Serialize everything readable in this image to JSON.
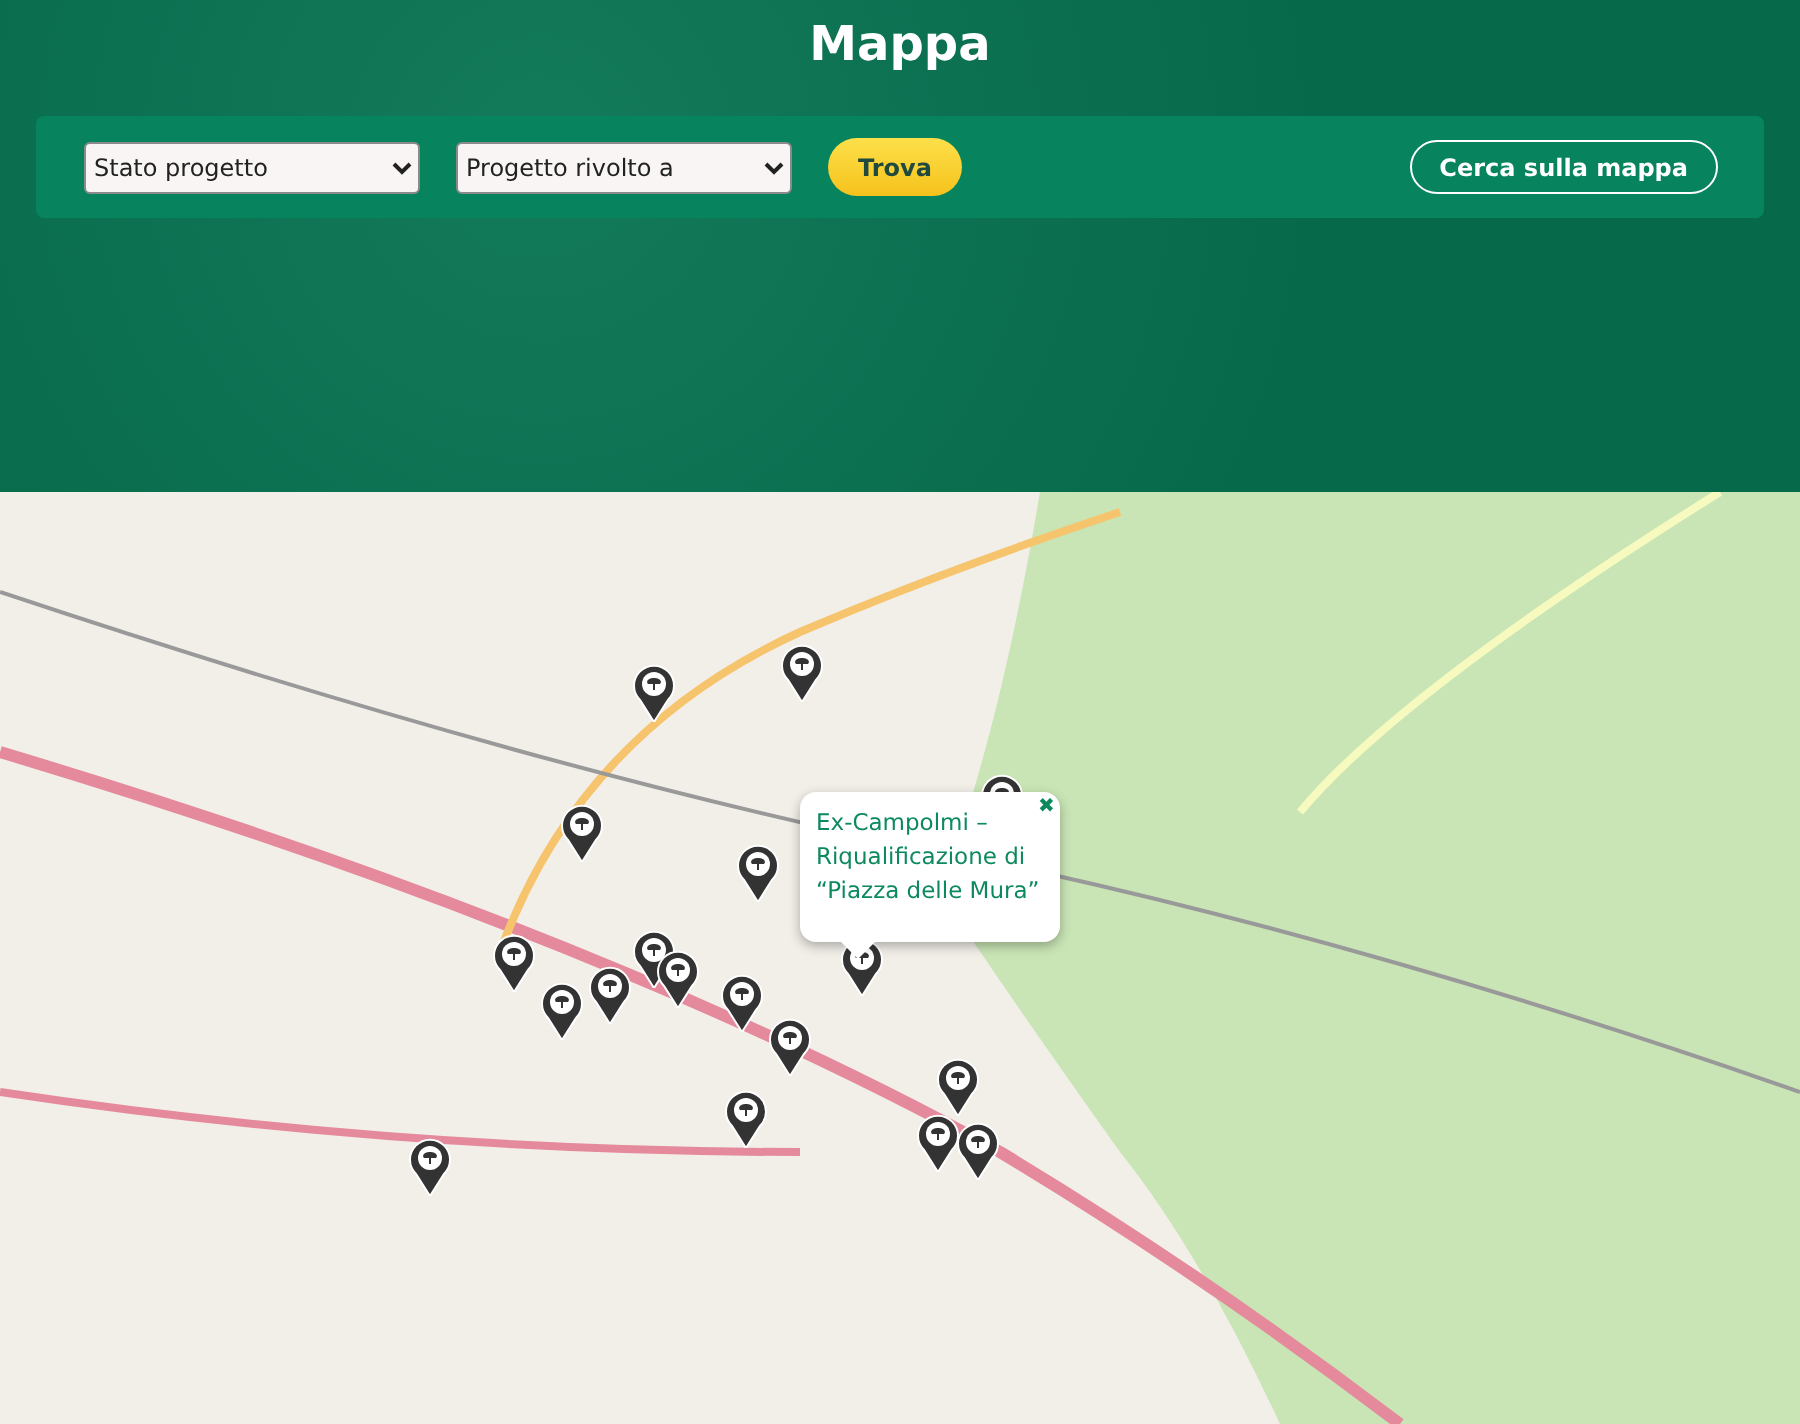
{
  "header": {
    "title": "Mappa"
  },
  "filters": {
    "selects": [
      {
        "value": "Stato progetto"
      },
      {
        "value": "Progetto rivolto a"
      }
    ],
    "find_button": "Trova",
    "map_search_button": "Cerca sulla mappa"
  },
  "map": {
    "popup": {
      "title": "Ex-Campolmi – Riqualificazione di “Piazza delle Mura”",
      "close": "✖"
    }
  }
}
